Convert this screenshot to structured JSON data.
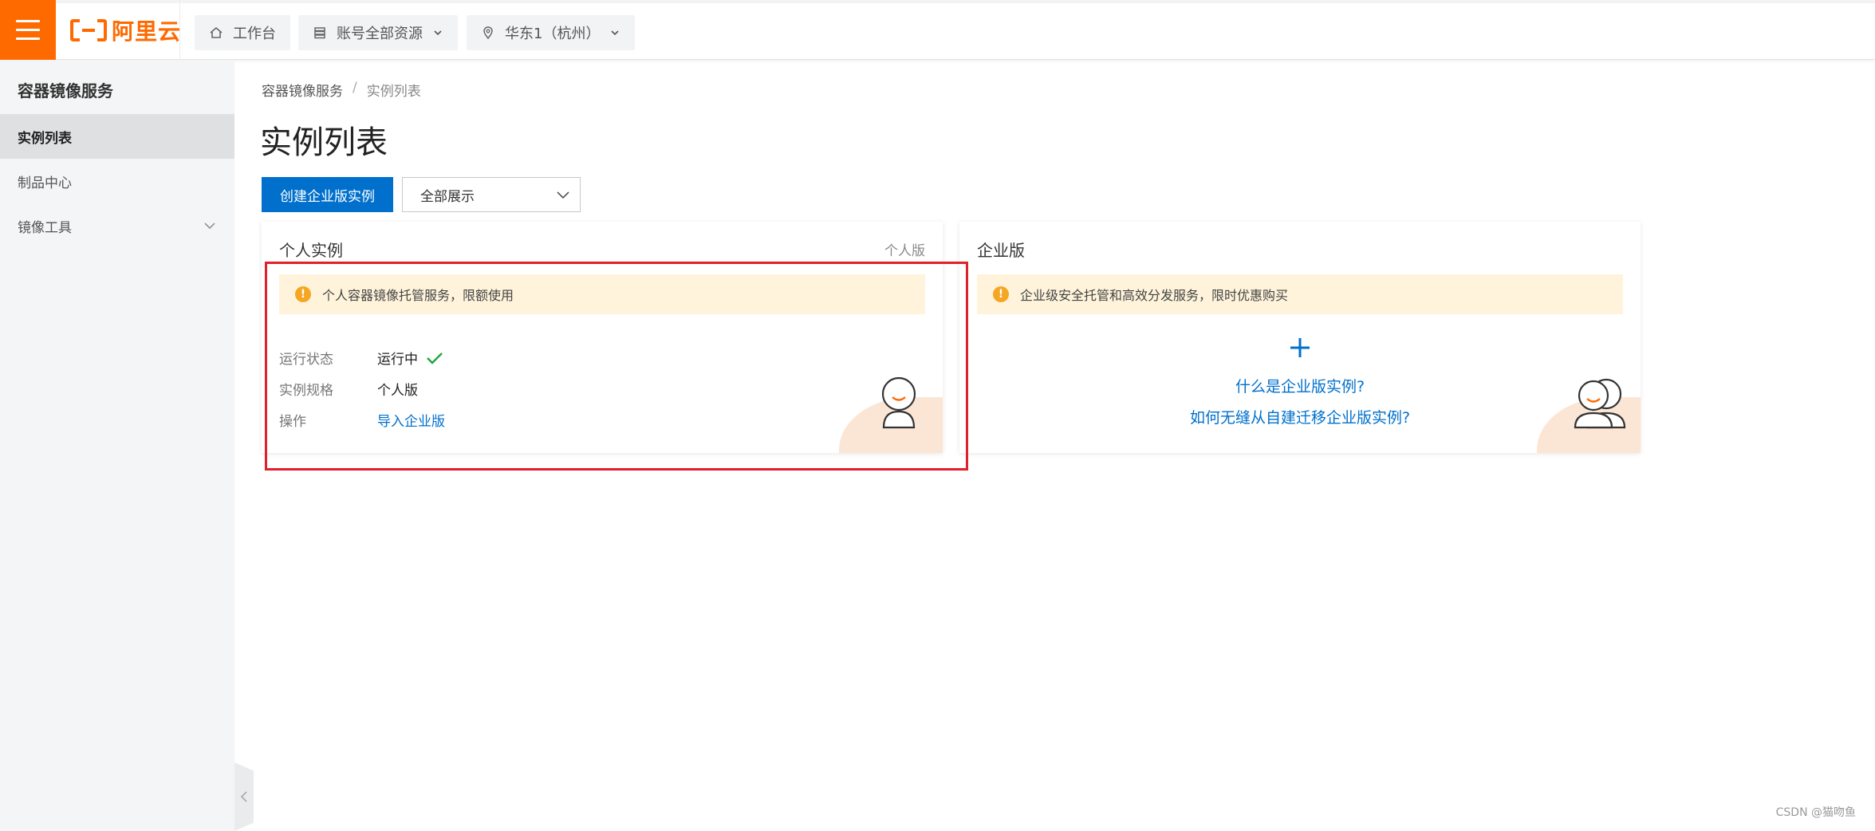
{
  "topbar": {
    "logo_text": "阿里云",
    "nav": [
      {
        "label": "工作台",
        "icon": "home-icon"
      },
      {
        "label": "账号全部资源",
        "icon": "stack-icon"
      },
      {
        "label": "华东1（杭州）",
        "icon": "location-icon"
      }
    ],
    "brand_color": "#ff6a00"
  },
  "sidebar": {
    "title": "容器镜像服务",
    "items": [
      {
        "label": "实例列表",
        "active": true
      },
      {
        "label": "制品中心",
        "active": false
      },
      {
        "label": "镜像工具",
        "active": false,
        "expandable": true
      }
    ]
  },
  "breadcrumb": {
    "root": "容器镜像服务",
    "separator": "/",
    "current": "实例列表"
  },
  "page": {
    "title": "实例列表",
    "create_button": "创建企业版实例",
    "filter_select": "全部展示",
    "accent_color": "#0070cc"
  },
  "personal_card": {
    "title": "个人实例",
    "tag": "个人版",
    "notice": "个人容器镜像托管服务，限额使用",
    "rows": [
      {
        "key": "运行状态",
        "value": "运行中"
      },
      {
        "key": "实例规格",
        "value": "个人版"
      },
      {
        "key": "操作",
        "value": "导入企业版"
      }
    ]
  },
  "enterprise_card": {
    "title": "企业版",
    "notice": "企业级安全托管和高效分发服务，限时优惠购买",
    "plus": "+",
    "link1": "什么是企业版实例?",
    "link2": "如何无缝从自建迁移企业版实例?"
  },
  "watermark": "CSDN @猫吻鱼"
}
